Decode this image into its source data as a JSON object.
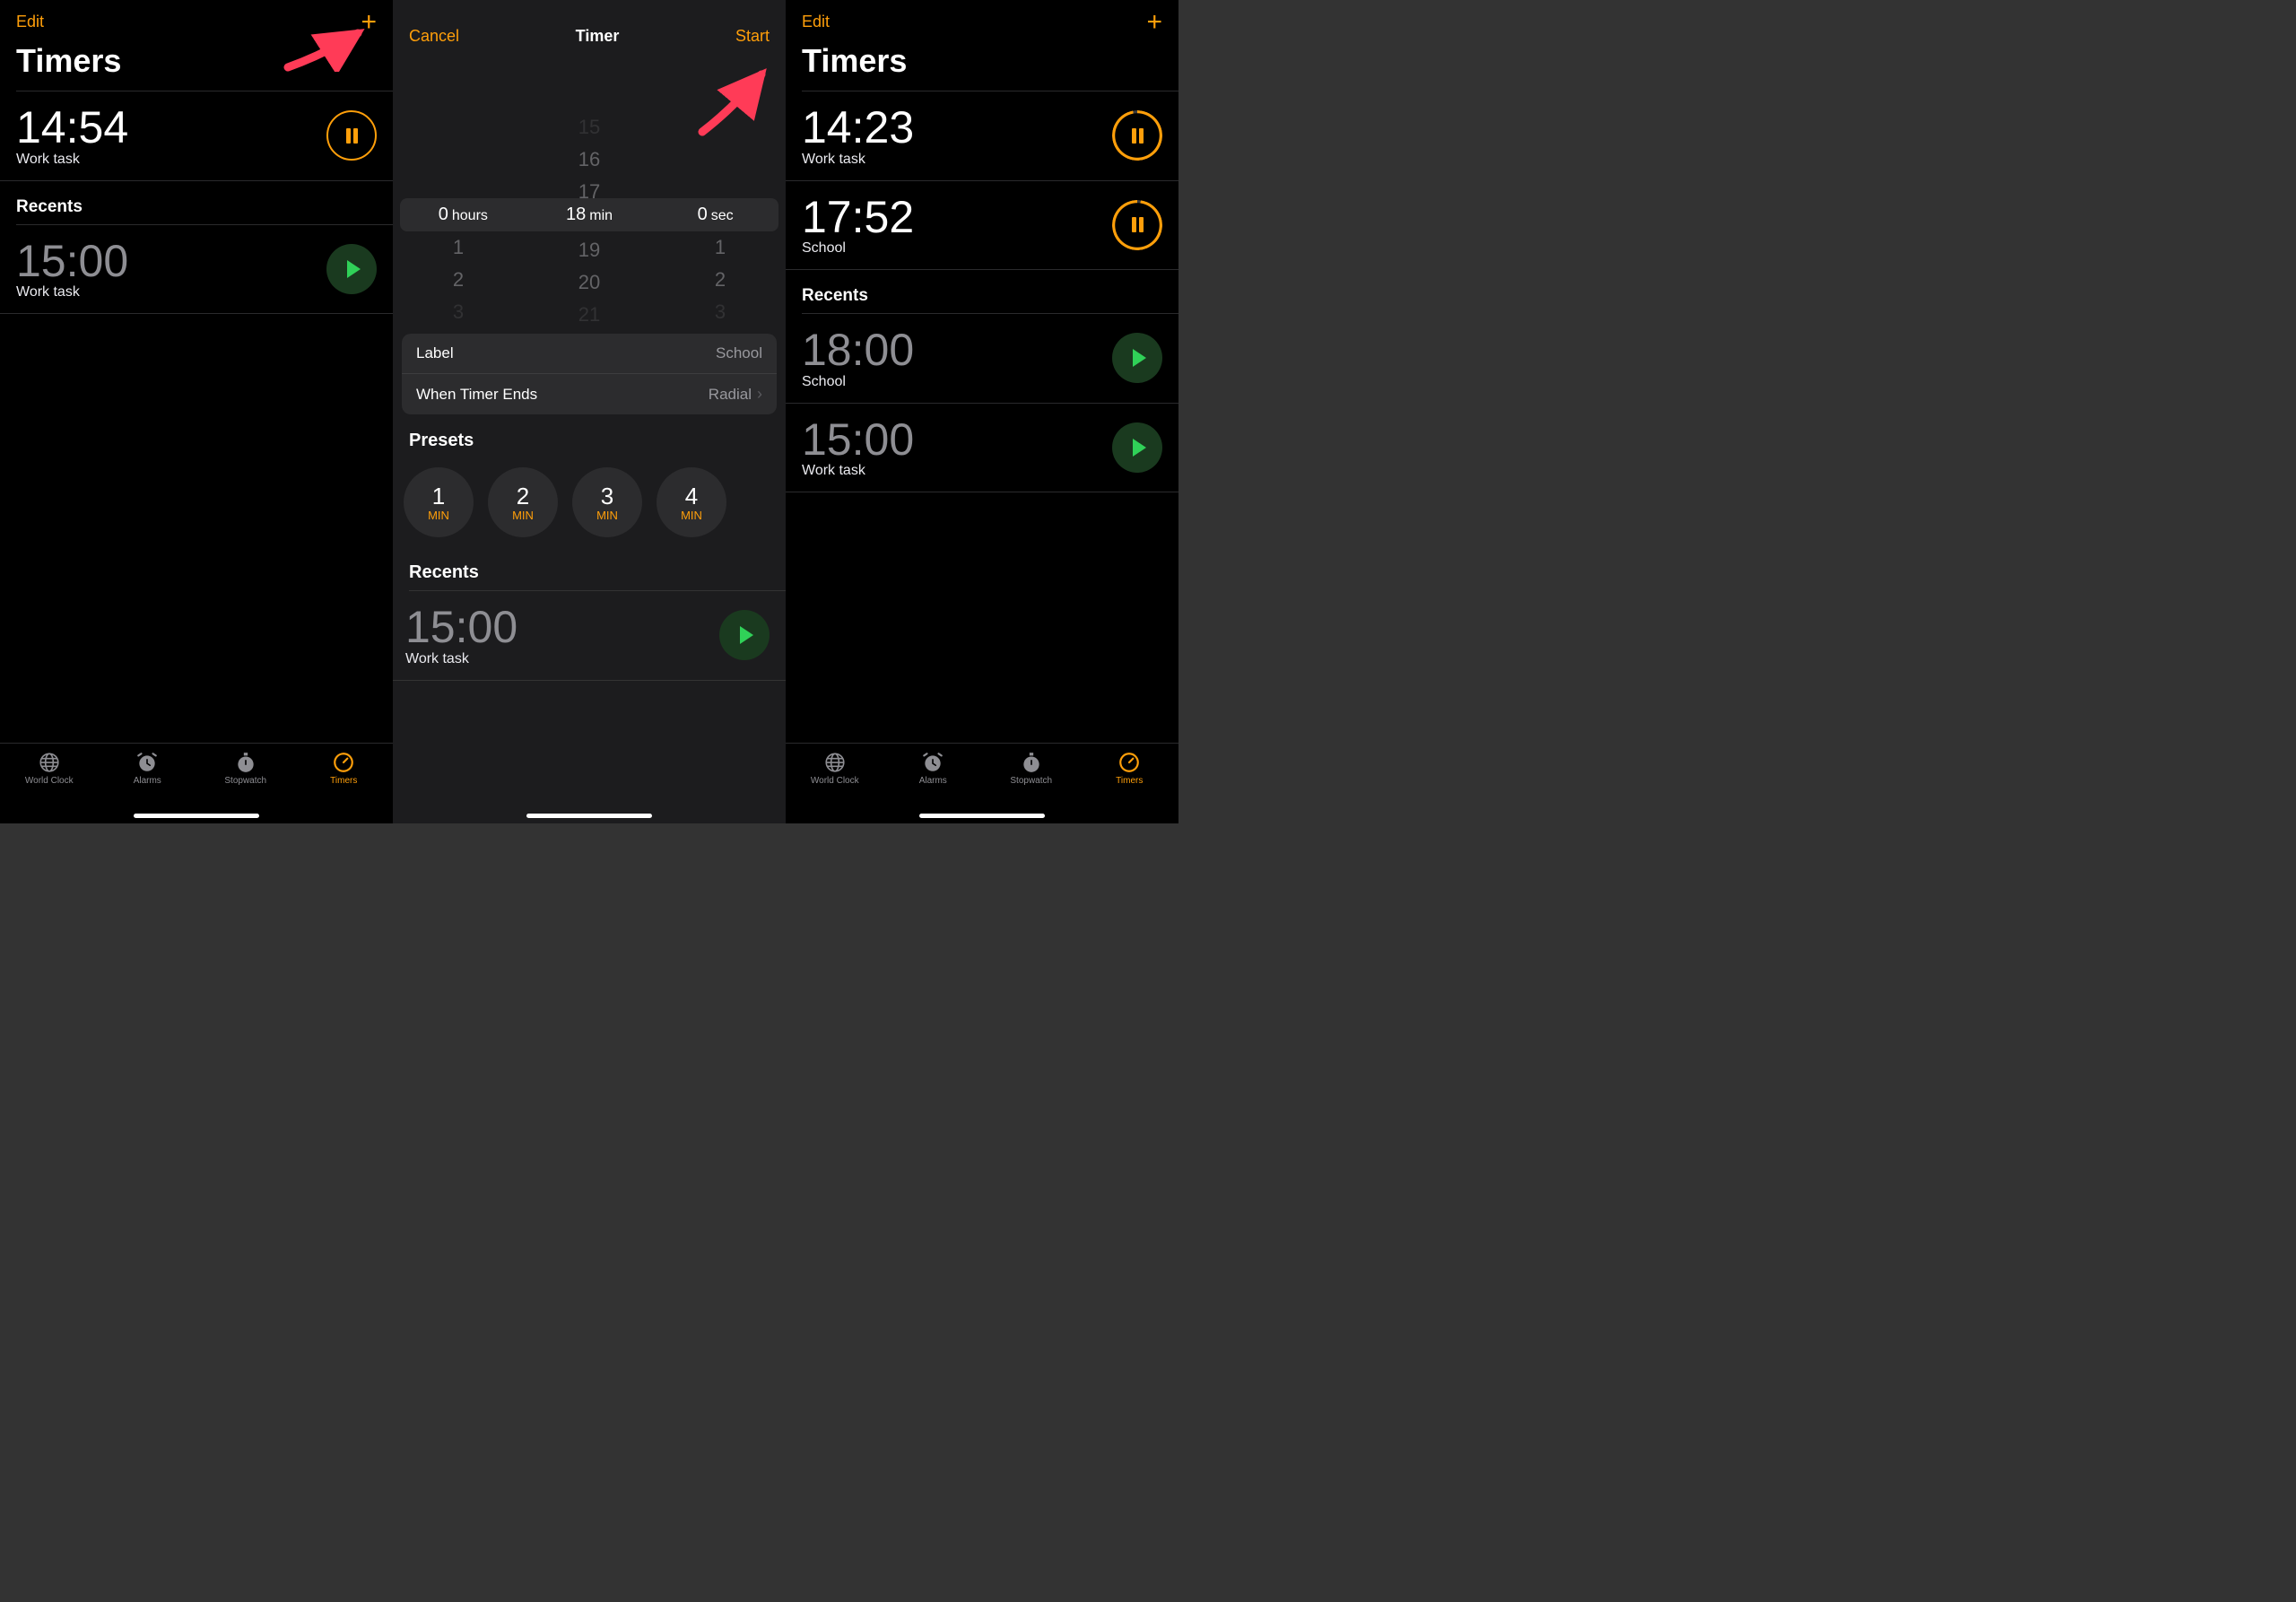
{
  "screens": {
    "s1": {
      "edit": "Edit",
      "title": "Timers",
      "running": [
        {
          "time": "14:54",
          "label": "Work task"
        }
      ],
      "recents_title": "Recents",
      "recents": [
        {
          "time": "15:00",
          "label": "Work task"
        }
      ]
    },
    "s2": {
      "cancel": "Cancel",
      "title": "Timer",
      "start": "Start",
      "picker": {
        "hours_val": "0",
        "hours_unit": "hours",
        "min_val": "18",
        "min_unit": "min",
        "sec_val": "0",
        "sec_unit": "sec",
        "above": [
          "15",
          "16",
          "17"
        ],
        "below": [
          "19",
          "20",
          "21"
        ],
        "h_below": [
          "1",
          "2",
          "3"
        ],
        "s_below": [
          "1",
          "2",
          "3"
        ]
      },
      "settings": {
        "label_k": "Label",
        "label_v": "School",
        "ends_k": "When Timer Ends",
        "ends_v": "Radial"
      },
      "presets_title": "Presets",
      "presets": [
        {
          "n": "1",
          "u": "MIN"
        },
        {
          "n": "2",
          "u": "MIN"
        },
        {
          "n": "3",
          "u": "MIN"
        },
        {
          "n": "4",
          "u": "MIN"
        }
      ],
      "recents_title": "Recents",
      "recents": [
        {
          "time": "15:00",
          "label": "Work task"
        }
      ]
    },
    "s3": {
      "edit": "Edit",
      "title": "Timers",
      "running": [
        {
          "time": "14:23",
          "label": "Work task"
        },
        {
          "time": "17:52",
          "label": "School"
        }
      ],
      "recents_title": "Recents",
      "recents": [
        {
          "time": "18:00",
          "label": "School"
        },
        {
          "time": "15:00",
          "label": "Work task"
        }
      ]
    }
  },
  "tabs": {
    "world": "World Clock",
    "alarms": "Alarms",
    "stopwatch": "Stopwatch",
    "timers": "Timers"
  },
  "colors": {
    "accent": "#ff9f0a",
    "play": "#30d158"
  }
}
